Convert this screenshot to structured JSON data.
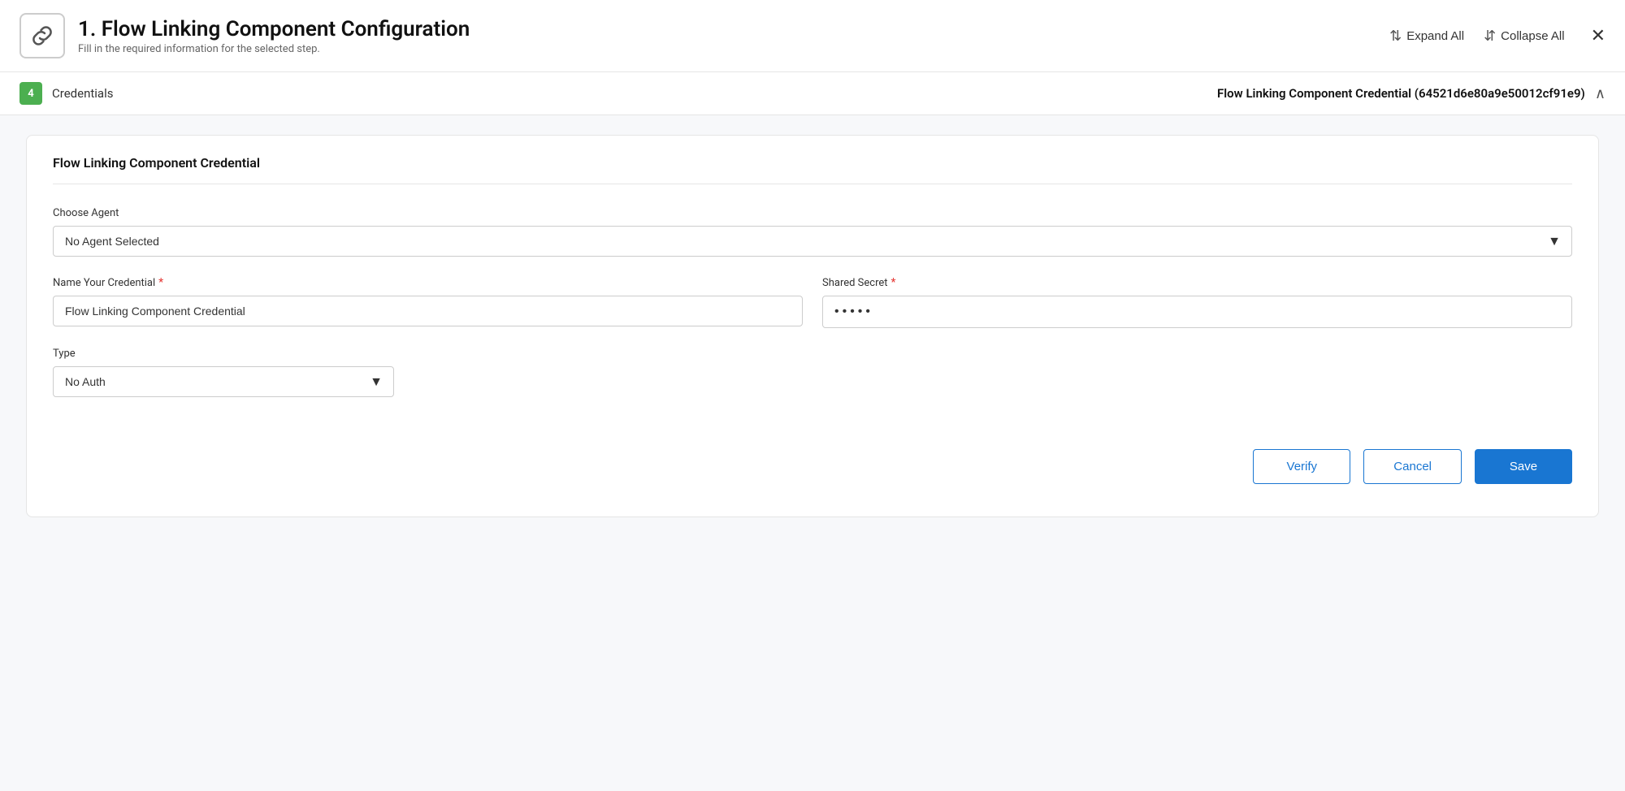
{
  "header": {
    "icon_alt": "link-icon",
    "title": "1. Flow Linking Component Configuration",
    "subtitle": "Fill in the required information for the selected step.",
    "expand_all_label": "Expand All",
    "collapse_all_label": "Collapse All",
    "close_label": "✕"
  },
  "section": {
    "badge": "4",
    "label": "Credentials",
    "credential_info": "Flow Linking Component Credential (64521d6e80a9e50012cf91e9)"
  },
  "form": {
    "card_title": "Flow Linking Component Credential",
    "choose_agent_label": "Choose Agent",
    "agent_select_value": "No Agent Selected",
    "agent_options": [
      "No Agent Selected"
    ],
    "credential_name_label": "Name Your Credential",
    "credential_name_required": true,
    "credential_name_value": "Flow Linking Component Credential",
    "shared_secret_label": "Shared Secret",
    "shared_secret_required": true,
    "shared_secret_value": "•••••",
    "type_label": "Type",
    "type_select_value": "No Auth",
    "type_options": [
      "No Auth"
    ],
    "verify_label": "Verify",
    "cancel_label": "Cancel",
    "save_label": "Save"
  }
}
